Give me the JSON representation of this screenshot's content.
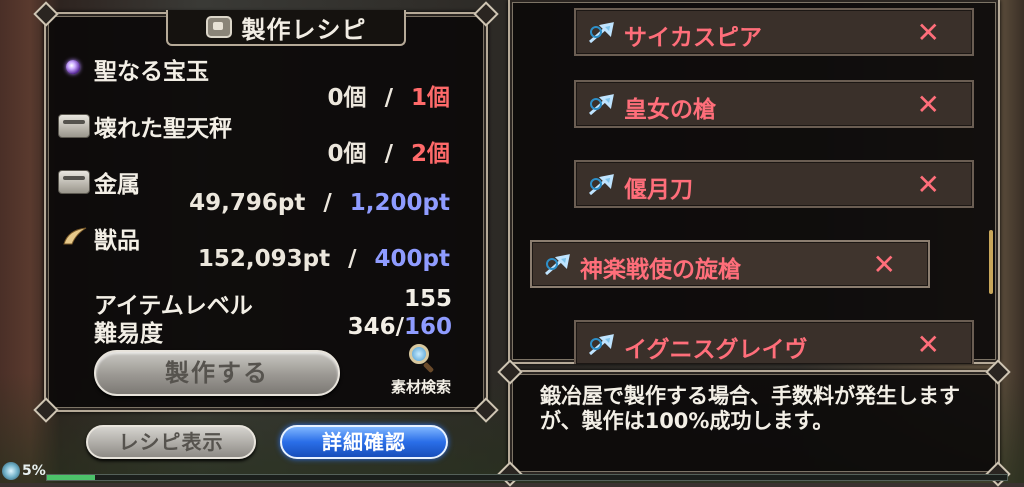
{
  "recipe": {
    "title": "製作レシピ",
    "materials": [
      {
        "name": "聖なる宝玉",
        "icon": "gem-icon",
        "have": "0個",
        "sep": "/",
        "need": "1個",
        "need_color": "red"
      },
      {
        "name": "壊れた聖天秤",
        "icon": "ore-box-icon",
        "have": "0個",
        "sep": "/",
        "need": "2個",
        "need_color": "red"
      },
      {
        "name": "金属",
        "icon": "metal-box-icon",
        "have": "49,796pt",
        "sep": "/",
        "need": "1,200pt",
        "need_color": "blue"
      },
      {
        "name": "獣品",
        "icon": "horn-icon",
        "have": "152,093pt",
        "sep": "/",
        "need": "400pt",
        "need_color": "blue"
      }
    ],
    "item_level_label": "アイテムレベル",
    "item_level_value": "155",
    "difficulty_label": "難易度",
    "difficulty_current": "346/",
    "difficulty_target": "160",
    "craft_button": "製作する",
    "search_label": "素材検索"
  },
  "buttons": {
    "recipe_view": "レシピ表示",
    "detail_check": "詳細確認"
  },
  "list": {
    "items": [
      {
        "name": "サイカスピア",
        "selected": false
      },
      {
        "name": "皇女の槍",
        "selected": false
      },
      {
        "name": "偃月刀",
        "selected": false
      },
      {
        "name": "神楽戦使の旋槍",
        "selected": true
      },
      {
        "name": "イグニスグレイヴ",
        "selected": false
      }
    ],
    "status_mark": "✕"
  },
  "description": "鍛冶屋で製作する場合、手数料が発生しますが、製作は100%成功します。",
  "status": {
    "exp_percent_label": "5%",
    "exp_fraction": 0.05
  },
  "colors": {
    "required_insufficient": "#ff6a6a",
    "required_points": "#8f9cff",
    "list_item_text": "#ff6e7a",
    "detail_button": "#2a6ee8"
  }
}
